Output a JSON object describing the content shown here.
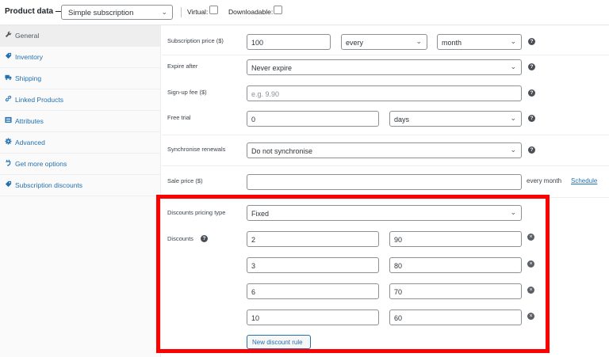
{
  "header": {
    "title": "Product data —",
    "product_type": "Simple subscription",
    "virtual_label": "Virtual:",
    "downloadable_label": "Downloadable:"
  },
  "sidebar": {
    "items": [
      {
        "label": "General",
        "icon": "wrench-icon"
      },
      {
        "label": "Inventory",
        "icon": "tag-icon"
      },
      {
        "label": "Shipping",
        "icon": "truck-icon"
      },
      {
        "label": "Linked Products",
        "icon": "link-icon"
      },
      {
        "label": "Attributes",
        "icon": "list-icon"
      },
      {
        "label": "Advanced",
        "icon": "gear-icon"
      },
      {
        "label": "Get more options",
        "icon": "plugin-icon"
      },
      {
        "label": "Subscription discounts",
        "icon": "tag-icon"
      }
    ]
  },
  "fields": {
    "subscription_price": {
      "label": "Subscription price ($)",
      "value": "100",
      "interval": "every",
      "period": "month"
    },
    "expire_after": {
      "label": "Expire after",
      "value": "Never expire"
    },
    "signup_fee": {
      "label": "Sign-up fee ($)",
      "placeholder": "e.g. 9.90"
    },
    "free_trial": {
      "label": "Free trial",
      "value": "0",
      "unit": "days"
    },
    "sync_renewals": {
      "label": "Synchronise renewals",
      "value": "Do not synchronise"
    },
    "sale_price": {
      "label": "Sale price ($)",
      "value": "",
      "suffix": "every month",
      "schedule_link": "Schedule"
    }
  },
  "discounts": {
    "pricing_type_label": "Discounts pricing type",
    "pricing_type": "Fixed",
    "label": "Discounts",
    "rules": [
      {
        "qty": "2",
        "amount": "90"
      },
      {
        "qty": "3",
        "amount": "80"
      },
      {
        "qty": "6",
        "amount": "70"
      },
      {
        "qty": "10",
        "amount": "60"
      }
    ],
    "add_button": "New discount rule"
  },
  "colors": {
    "accent": "#2271b1",
    "highlight": "#ff0000"
  }
}
